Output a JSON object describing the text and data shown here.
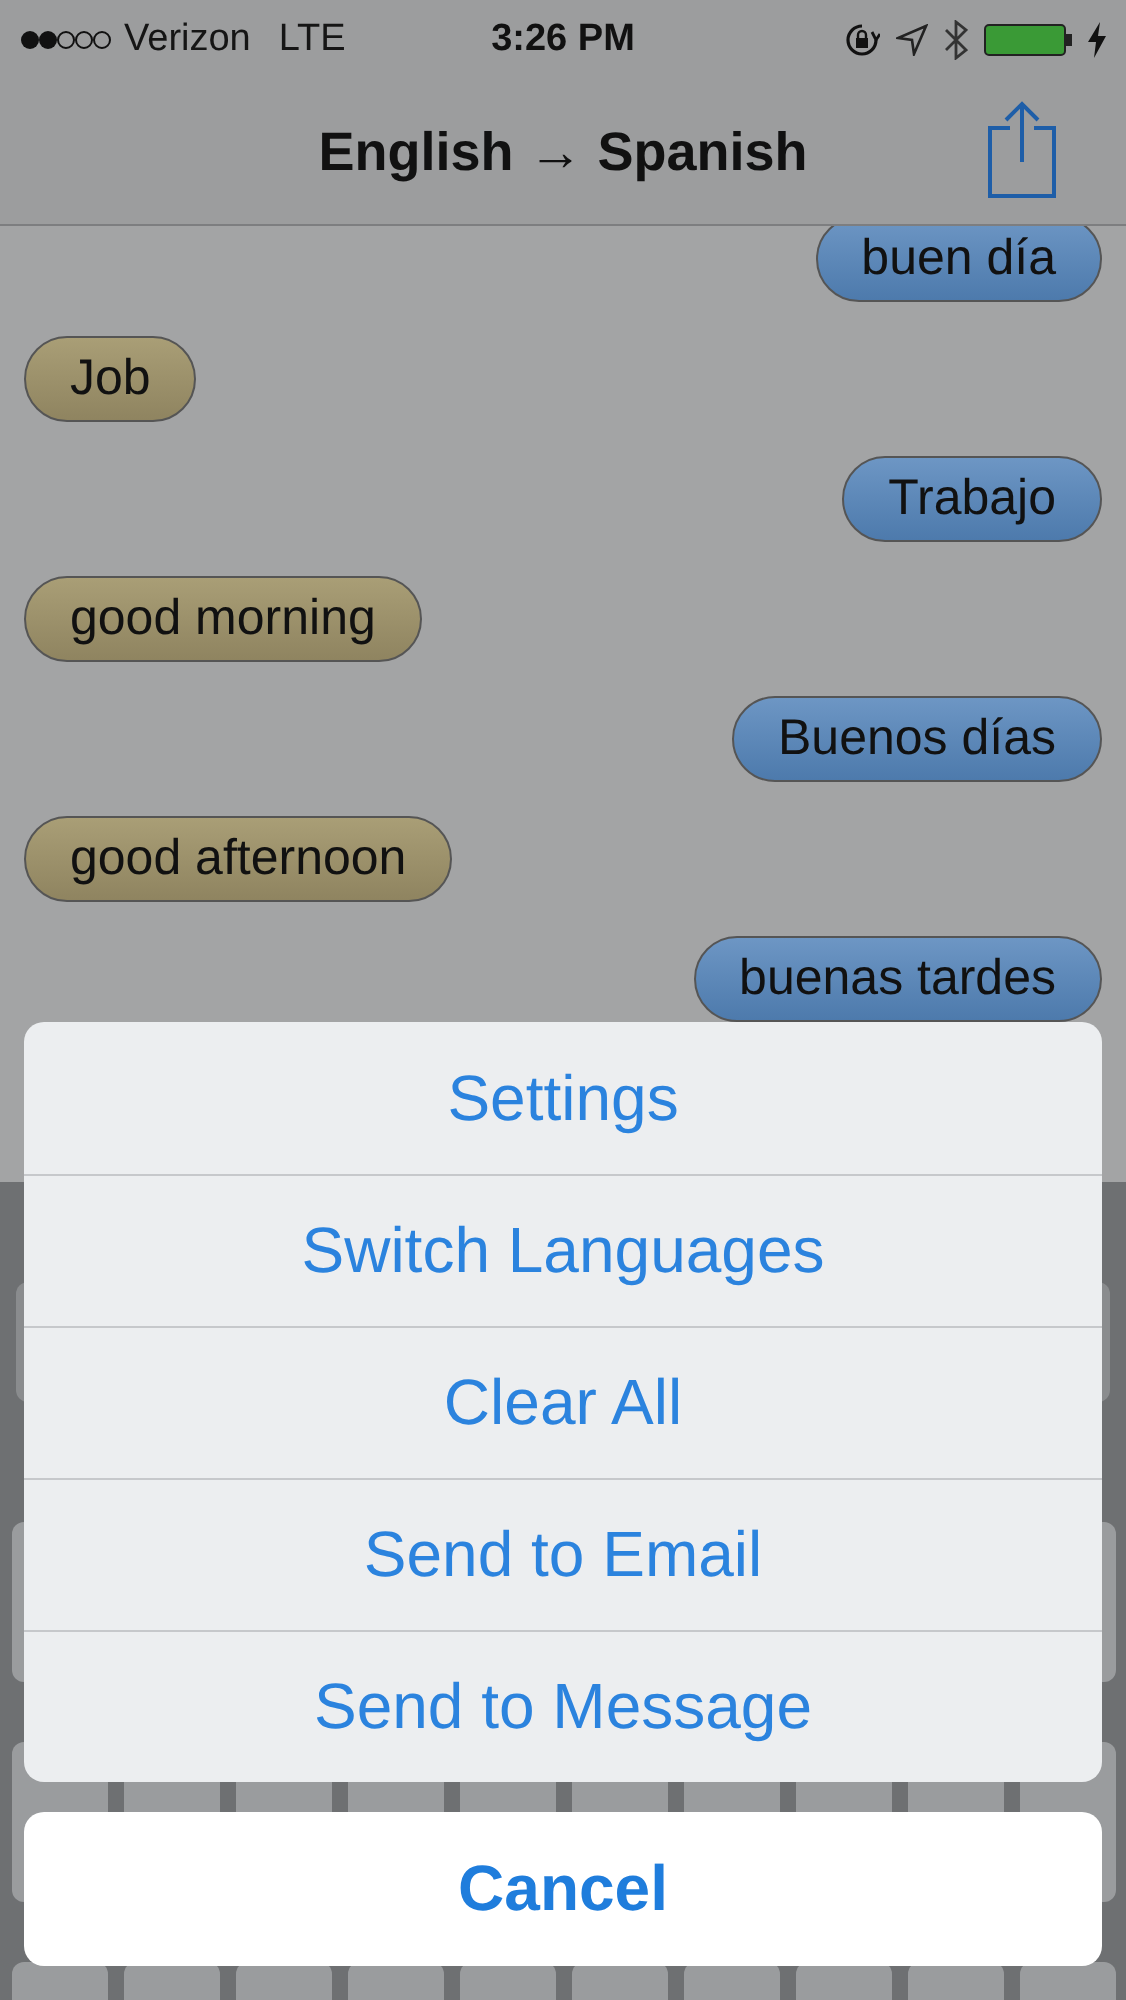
{
  "status_bar": {
    "carrier": "Verizon",
    "network": "LTE",
    "time": "3:26 PM"
  },
  "nav_bar": {
    "title": "English → Spanish"
  },
  "messages": [
    {
      "kind": "sent",
      "text": "buen día"
    },
    {
      "kind": "received",
      "text": "Job"
    },
    {
      "kind": "sent",
      "text": "Trabajo"
    },
    {
      "kind": "received",
      "text": "good morning"
    },
    {
      "kind": "sent",
      "text": "Buenos días"
    },
    {
      "kind": "received",
      "text": "good afternoon"
    },
    {
      "kind": "sent",
      "text": "buenas tardes"
    }
  ],
  "action_sheet": {
    "options": [
      "Settings",
      "Switch Languages",
      "Clear All",
      "Send to Email",
      "Send to Message"
    ],
    "cancel": "Cancel"
  }
}
